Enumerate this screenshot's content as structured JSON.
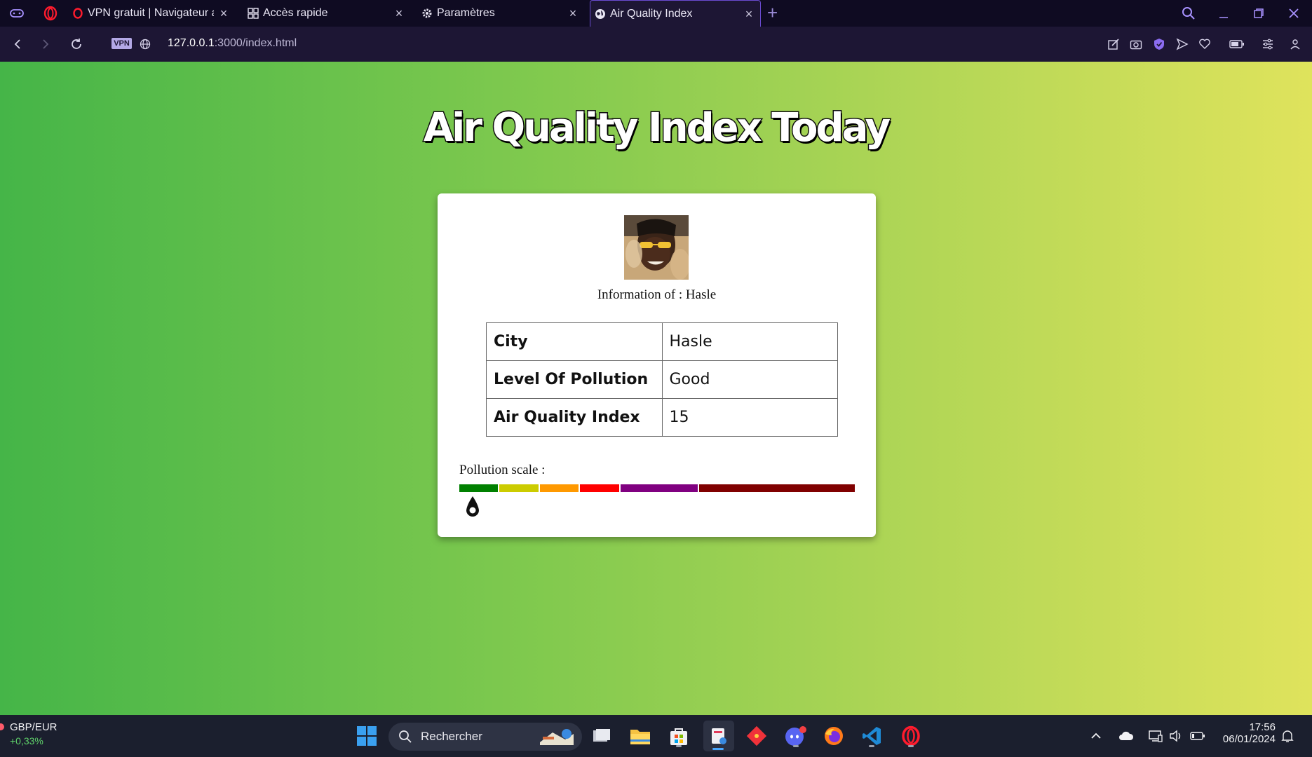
{
  "browser": {
    "tabs": [
      {
        "title": "VPN gratuit | Navigateur av",
        "icon": "opera-icon"
      },
      {
        "title": "Accès rapide",
        "icon": "grid-icon"
      },
      {
        "title": "Paramètres",
        "icon": "gear-icon"
      },
      {
        "title": "Air Quality Index",
        "icon": "globe-icon",
        "active": true
      }
    ],
    "vpn_label": "VPN",
    "url_host": "127.0.0.1",
    "url_rest": ":3000/index.html"
  },
  "page": {
    "title": "Air Quality Index Today",
    "info_line": "Information of : Hasle",
    "table": [
      {
        "label": "City",
        "value": "Hasle"
      },
      {
        "label": "Level Of Pollution",
        "value": "Good"
      },
      {
        "label": "Air Quality Index",
        "value": "15"
      }
    ],
    "scale_label": "Pollution scale :",
    "scale_colors": [
      "#008000",
      "#cccc00",
      "#ff9900",
      "#ff0000",
      "#800080",
      "#800000"
    ],
    "scale_weights": [
      1,
      1,
      1,
      1,
      2,
      4
    ],
    "aqi_value": 15
  },
  "taskbar": {
    "ticker_symbol": "GBP/EUR",
    "ticker_change": "+0,33%",
    "search_placeholder": "Rechercher",
    "time": "17:56",
    "date": "06/01/2024"
  },
  "colors": {
    "accent": "#6a4bd1",
    "gradient_start": "#45b548",
    "gradient_end": "#dfe35c"
  }
}
